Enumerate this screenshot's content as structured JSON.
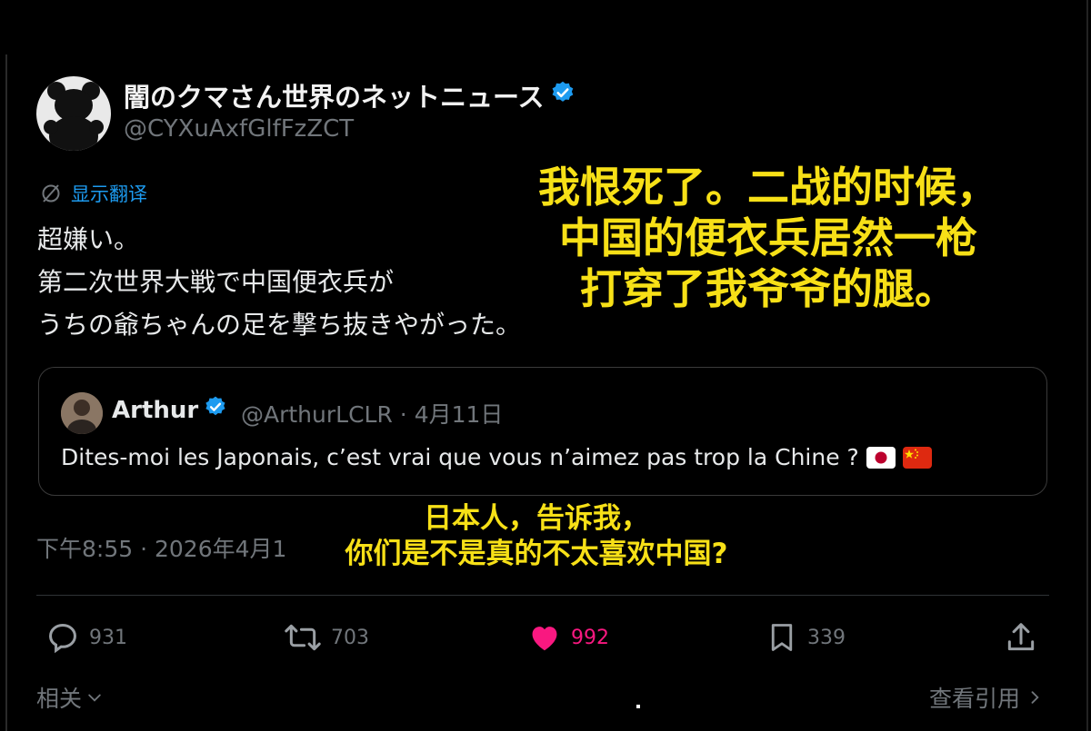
{
  "author": {
    "display_name": "闇のクマさん世界のネットニュース",
    "handle": "@CYXuAxfGlfFzZCT",
    "avatar_icon": "black-bear-silhouette-icon",
    "verified_icon": "verified-badge-icon"
  },
  "translate": {
    "label": "显示翻译",
    "icon": "translate-icon"
  },
  "post": {
    "lines": [
      "超嫌い。",
      "第二次世界大戦で中国便衣兵が",
      "うちの爺ちゃんの足を撃ち抜きやがった。"
    ]
  },
  "overlay_caption_top": {
    "lines": [
      "我恨死了。二战的时候，",
      "中国的便衣兵居然一枪",
      "打穿了我爷爷的腿。"
    ],
    "color": "#f7e017"
  },
  "quoted_post": {
    "name": "Arthur",
    "handle": "@ArthurLCLR",
    "separator": "·",
    "date": "4月11日",
    "text": "Dites-moi les Japonais, c’est vrai que vous n’aimez pas trop la Chine ?",
    "flags": [
      "japan-flag-icon",
      "china-flag-icon"
    ]
  },
  "timestamp": "下午8:55 · 2026年4月1",
  "overlay_caption_bottom": {
    "lines": [
      "日本人，告诉我，",
      "你们是不是真的不太喜欢中国?"
    ]
  },
  "actions": {
    "reply": {
      "icon": "reply-icon",
      "count": "931"
    },
    "repost": {
      "icon": "repost-icon",
      "count": "703"
    },
    "like": {
      "icon": "heart-icon",
      "count": "992",
      "active": true,
      "color": "#f91880"
    },
    "bookmark": {
      "icon": "bookmark-icon",
      "count": "339"
    },
    "share": {
      "icon": "share-icon"
    }
  },
  "footer": {
    "related_label": "相关",
    "view_quotes_label": "查看引用"
  }
}
